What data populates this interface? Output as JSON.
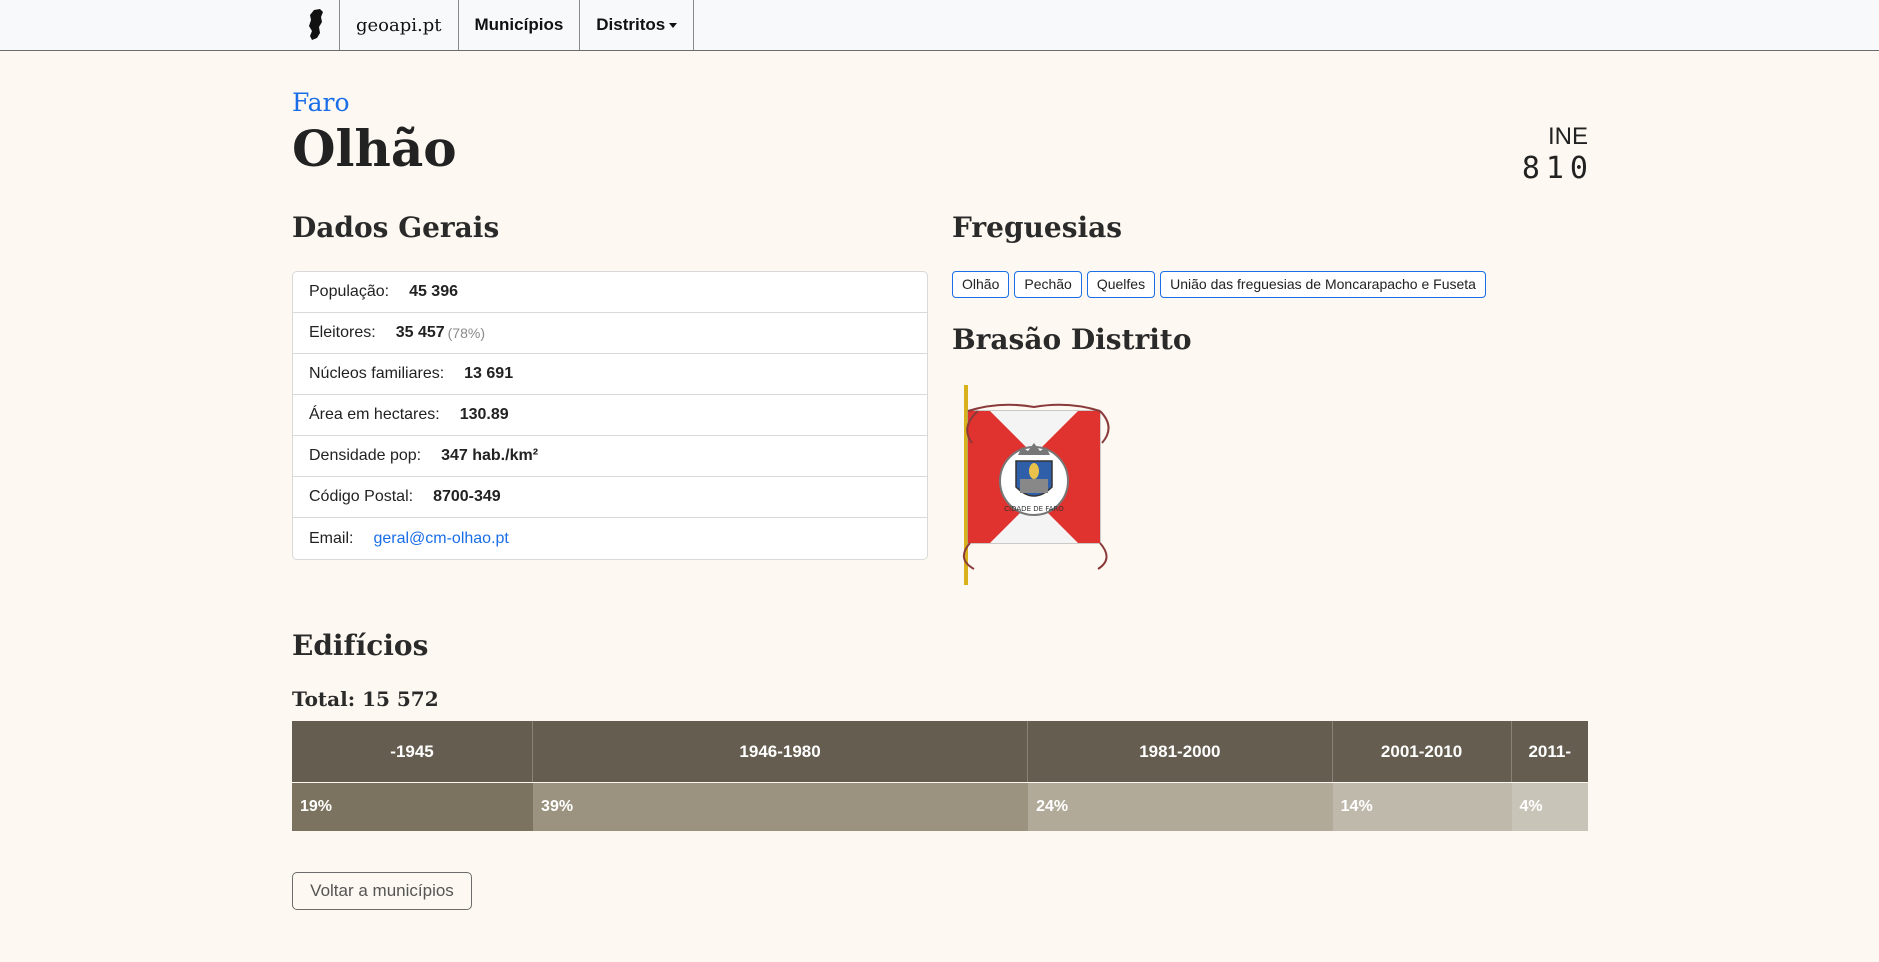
{
  "nav": {
    "brand": "geoapi.pt",
    "municipios": "Municípios",
    "distritos": "Distritos"
  },
  "header": {
    "district": "Faro",
    "title": "Olhão",
    "ine_label": "INE",
    "ine_code": "810"
  },
  "dados_gerais": {
    "heading": "Dados Gerais",
    "rows": [
      {
        "label": "População:",
        "value": "45 396"
      },
      {
        "label": "Eleitores:",
        "value": "35 457",
        "extra": "(78%)"
      },
      {
        "label": "Núcleos familiares:",
        "value": "13 691"
      },
      {
        "label": "Área em hectares:",
        "value": "130.89"
      },
      {
        "label": "Densidade pop:",
        "value": "347 hab./km²"
      },
      {
        "label": "Código Postal:",
        "value": "8700-349"
      },
      {
        "label": "Email:",
        "value": "geral@cm-olhao.pt"
      }
    ]
  },
  "freguesias": {
    "heading": "Freguesias",
    "items": [
      "Olhão",
      "Pechão",
      "Quelfes",
      "União das freguesias de Moncarapacho e Fuseta"
    ]
  },
  "brasao": {
    "heading": "Brasão Distrito",
    "motto": "CIDADE DE FARO"
  },
  "edificios": {
    "heading": "Edifícios",
    "total": "Total: 15 572",
    "periods": [
      {
        "label": "-1945",
        "pct": "19%",
        "share": 18.6,
        "color": "#7b735f"
      },
      {
        "label": "1946-1980",
        "pct": "39%",
        "share": 38.2,
        "color": "#9b9380"
      },
      {
        "label": "1981-2000",
        "pct": "24%",
        "share": 23.5,
        "color": "#b1aa99"
      },
      {
        "label": "2001-2010",
        "pct": "14%",
        "share": 13.8,
        "color": "#bfb9ab"
      },
      {
        "label": "2011-",
        "pct": "4%",
        "share": 5.9,
        "color": "#c9c4b8"
      }
    ]
  },
  "back_button": "Voltar a municípios"
}
